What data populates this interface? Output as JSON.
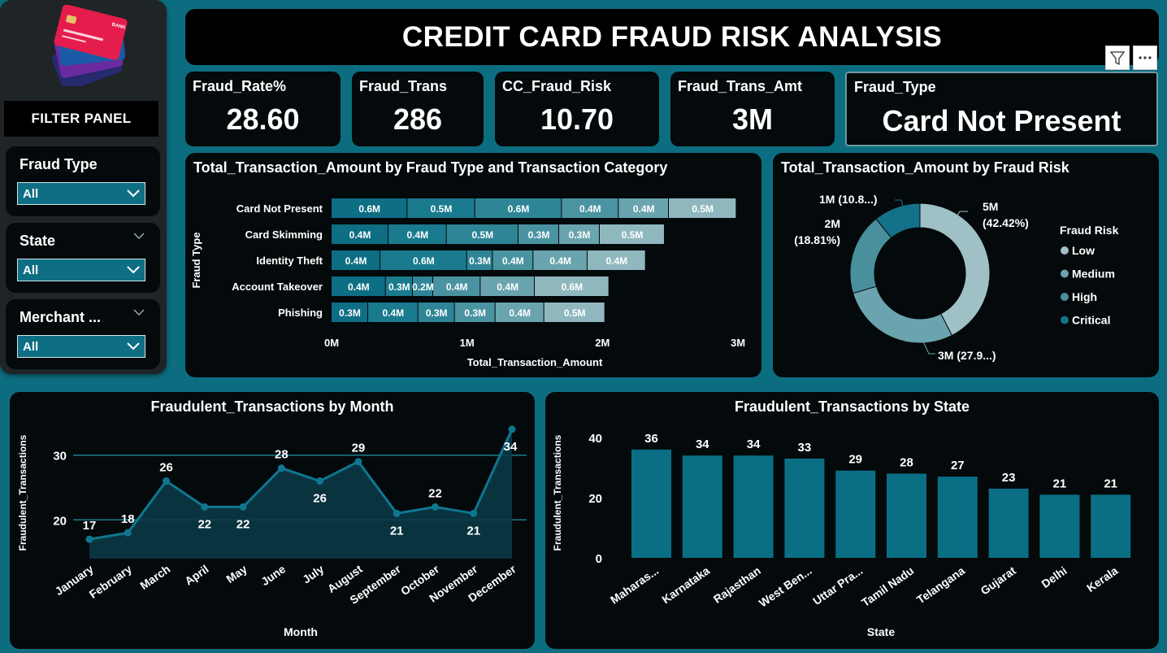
{
  "title": "CREDIT CARD FRAUD RISK ANALYSIS",
  "filter_panel": {
    "title": "FILTER PANEL",
    "slicers": [
      {
        "label": "Fraud Type",
        "value": "All"
      },
      {
        "label": "State",
        "value": "All"
      },
      {
        "label": "Merchant ...",
        "value": "All"
      }
    ],
    "card_brand_text": "BANK"
  },
  "kpis": {
    "fraud_rate": {
      "label": "Fraud_Rate%",
      "value": "28.60"
    },
    "fraud_trans": {
      "label": "Fraud_Trans",
      "value": "286"
    },
    "cc_fraud_risk": {
      "label": "CC_Fraud_Risk",
      "value": "10.70"
    },
    "fraud_trans_amt": {
      "label": "Fraud_Trans_Amt",
      "value": "3M"
    },
    "fraud_type": {
      "label": "Fraud_Type",
      "value": "Card Not Present"
    }
  },
  "toolbar": {
    "filter_icon": "filter-icon",
    "more_icon": "more-options-icon"
  },
  "colors": {
    "background": "#0c6d80",
    "panel": "#04090b",
    "bar": "#0a6f85",
    "stack": [
      "#0d6e84",
      "#1a7a8e",
      "#2e8596",
      "#4a93a1",
      "#6aa4ae",
      "#8fb8be"
    ],
    "donut": [
      "#9fc1c6",
      "#6aa4ae",
      "#4a8f9c",
      "#14718a"
    ]
  },
  "chart_data": [
    {
      "type": "bar",
      "orientation": "horizontal-stacked",
      "title": "Total_Transaction_Amount by Fraud Type and Transaction Category",
      "xlabel": "Total_Transaction_Amount",
      "ylabel": "Fraud Type",
      "xticks": [
        "0M",
        "1M",
        "2M",
        "3M"
      ],
      "xlim": [
        0,
        3
      ],
      "categories": [
        "Card Not Present",
        "Card Skimming",
        "Identity Theft",
        "Account Takeover",
        "Phishing"
      ],
      "segments": [
        [
          0.56,
          0.5,
          0.64,
          0.42,
          0.37,
          0.5
        ],
        [
          0.42,
          0.43,
          0.53,
          0.3,
          0.3,
          0.48
        ],
        [
          0.36,
          0.64,
          0.19,
          0.3,
          0.4,
          0.43
        ],
        [
          0.4,
          0.2,
          0.15,
          0.35,
          0.4,
          0.55
        ],
        [
          0.27,
          0.37,
          0.27,
          0.3,
          0.36,
          0.45
        ]
      ],
      "segment_labels": [
        [
          "0.6M",
          "0.5M",
          "0.6M",
          "0.4M",
          "0.4M",
          "0.5M"
        ],
        [
          "0.4M",
          "0.4M",
          "0.5M",
          "0.3M",
          "0.3M",
          "0.5M"
        ],
        [
          "0.4M",
          "0.6M",
          "0.3M",
          "0.4M",
          "0.4M",
          "0.4M"
        ],
        [
          "0.4M",
          "0.3M",
          "0.2M",
          "0.4M",
          "0.4M",
          "0.6M"
        ],
        [
          "0.3M",
          "0.4M",
          "0.3M",
          "0.3M",
          "0.4M",
          "0.5M"
        ]
      ]
    },
    {
      "type": "pie",
      "subtype": "donut",
      "title": "Total_Transaction_Amount by Fraud Risk",
      "legend_title": "Fraud Risk",
      "legend_position": "right",
      "slices": [
        {
          "name": "Low",
          "value": 42.42,
          "label": "5M\n(42.42%)"
        },
        {
          "name": "Medium",
          "value": 27.95,
          "label": "3M (27.9...)"
        },
        {
          "name": "High",
          "value": 18.81,
          "label": "2M\n(18.81%)"
        },
        {
          "name": "Critical",
          "value": 10.82,
          "label": "1M (10.8...)"
        }
      ]
    },
    {
      "type": "area",
      "title": "Fraudulent_Transactions by Month",
      "xlabel": "Month",
      "ylabel": "Fraudulent_Transactions",
      "yticks": [
        20,
        30
      ],
      "ylim": [
        14,
        35.5
      ],
      "grid": true,
      "x": [
        "January",
        "February",
        "March",
        "April",
        "May",
        "June",
        "July",
        "August",
        "September",
        "October",
        "November",
        "December"
      ],
      "values": [
        17,
        18,
        26,
        22,
        22,
        28,
        26,
        29,
        21,
        22,
        21,
        34
      ]
    },
    {
      "type": "bar",
      "title": "Fraudulent_Transactions by State",
      "xlabel": "State",
      "ylabel": "Fraudulent_Transactions",
      "yticks": [
        0,
        20,
        40
      ],
      "ylim": [
        0,
        40
      ],
      "categories": [
        "Maharas...",
        "Karnataka",
        "Rajasthan",
        "West Ben...",
        "Uttar Pra...",
        "Tamil Nadu",
        "Telangana",
        "Gujarat",
        "Delhi",
        "Kerala"
      ],
      "values": [
        36,
        34,
        34,
        33,
        29,
        28,
        27,
        23,
        21,
        21
      ]
    }
  ]
}
